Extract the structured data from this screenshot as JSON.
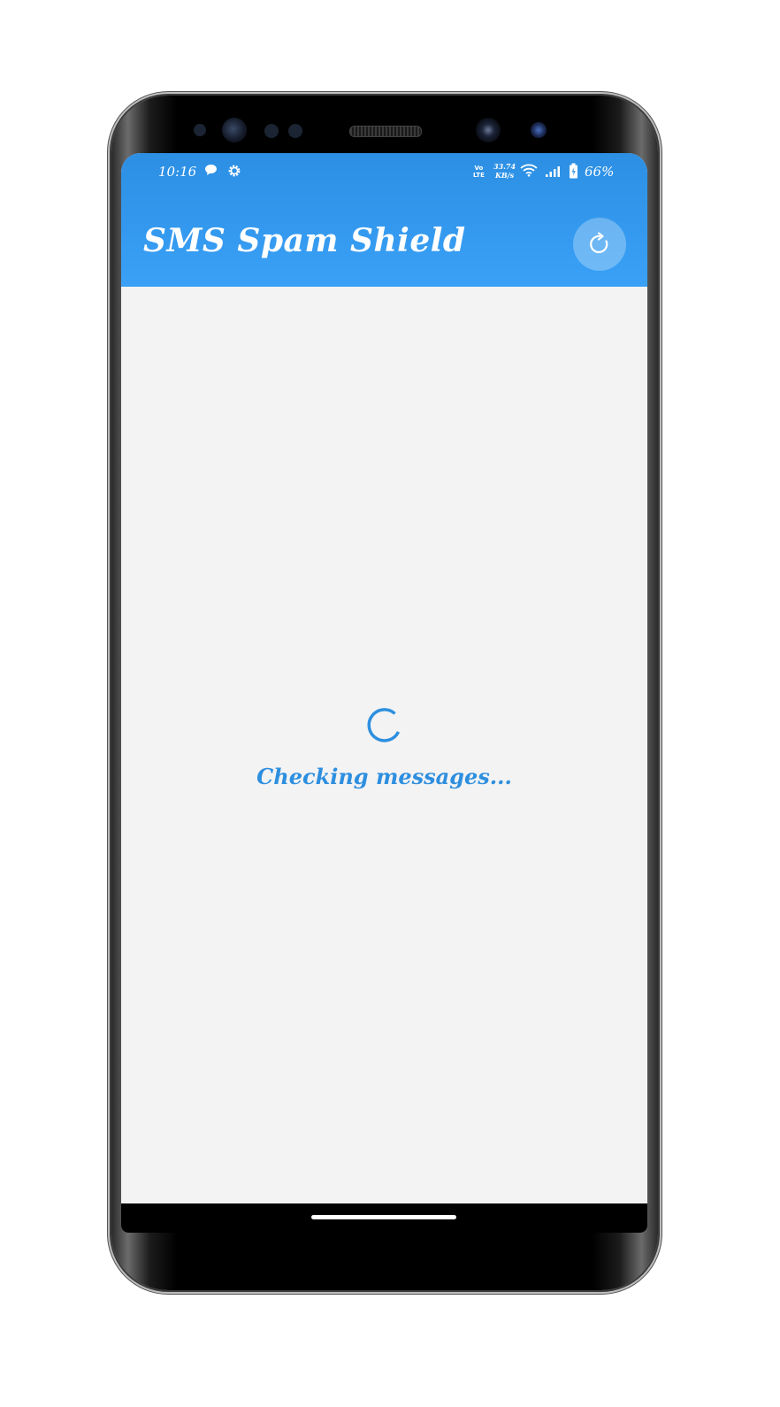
{
  "status_bar": {
    "time": "10:16",
    "volte_line1": "Vo",
    "volte_line2": "LTE",
    "speed_value": "33.74",
    "speed_unit": "KB/s",
    "battery_percent": "66%",
    "icons": [
      "message-icon",
      "gear-icon",
      "volte-icon",
      "wifi-icon",
      "signal-icon",
      "battery-icon"
    ]
  },
  "app_bar": {
    "title": "SMS Spam Shield",
    "background_color": "#3199ec",
    "refresh_icon": "refresh-icon"
  },
  "main": {
    "loading_text": "Checking messages...",
    "spinner_color": "#2e8fdf",
    "background_color": "#f3f3f4"
  }
}
